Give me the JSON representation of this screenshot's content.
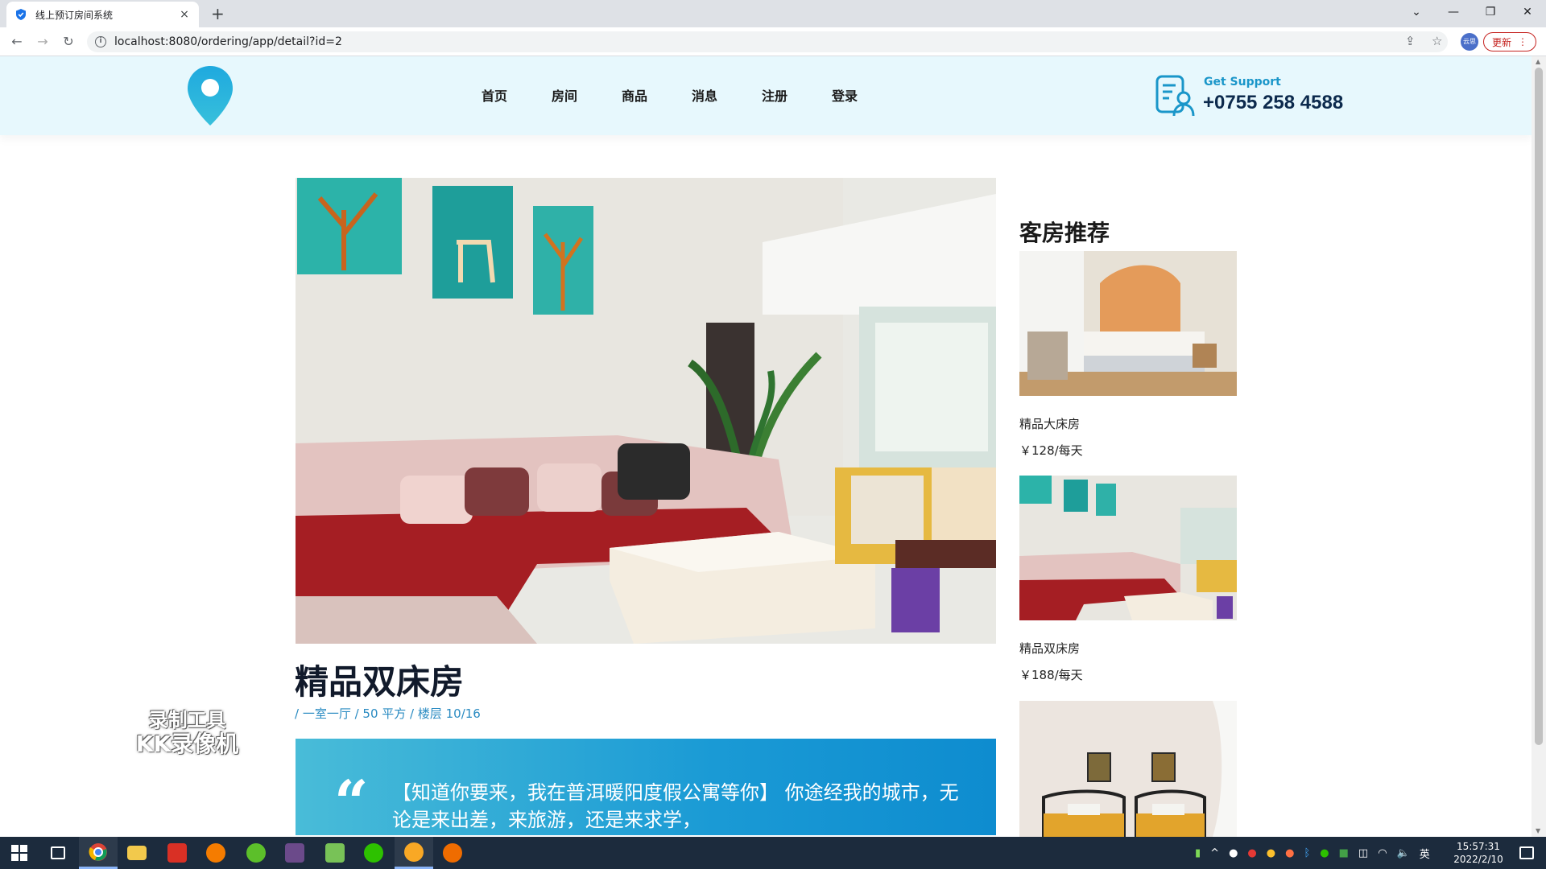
{
  "browser": {
    "tab_title": "线上预订房间系统",
    "tab_close": "×",
    "new_tab": "+",
    "url": "localhost:8080/ordering/app/detail?id=2",
    "update_label": "更新",
    "profile_label": "云思"
  },
  "header": {
    "nav": [
      "首页",
      "房间",
      "商品",
      "消息",
      "注册",
      "登录"
    ],
    "support_label": "Get Support",
    "support_phone": "+0755 258 4588"
  },
  "room": {
    "title": "精品双床房",
    "meta": "/ 一室一厅 / 50 平方 / 楼层 10/16",
    "quote": "【知道你要来，我在普洱暖阳度假公寓等你】 你途经我的城市，无论是来出差，来旅游，还是来求学，"
  },
  "sidebar": {
    "title": "客房推荐",
    "items": [
      {
        "name": "精品大床房",
        "price": "￥128/每天"
      },
      {
        "name": "精品双床房",
        "price": "￥188/每天"
      },
      {
        "name": "",
        "price": ""
      }
    ]
  },
  "watermark": {
    "line1": "录制工具",
    "line2": "KK录像机"
  },
  "taskbar": {
    "time": "15:57:31",
    "date": "2022/2/10",
    "lang": "英"
  },
  "colors": {
    "accent": "#1a96c9",
    "header_bg": "#e7f8fd",
    "quote_bg": "#1a9ad5"
  }
}
